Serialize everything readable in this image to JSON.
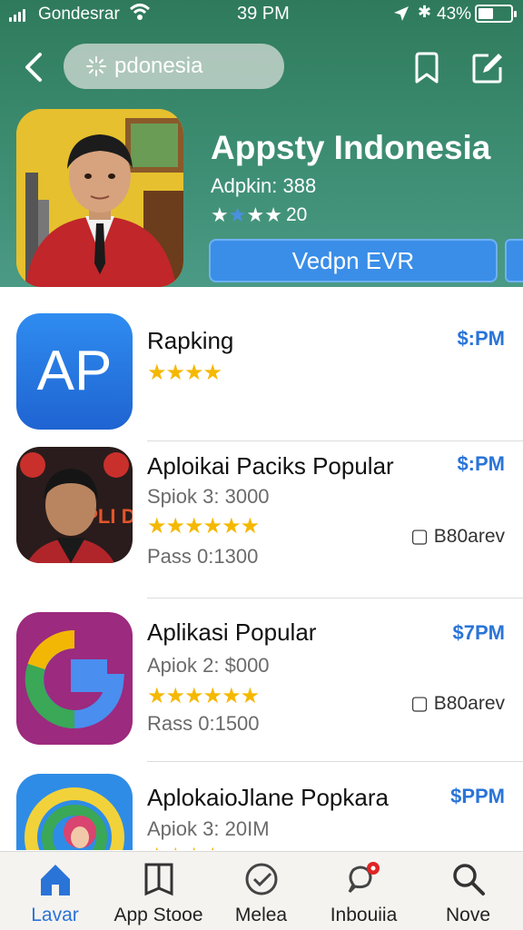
{
  "status_bar": {
    "carrier": "Gondesrar",
    "time": "39 PM",
    "battery": "43%"
  },
  "search": {
    "placeholder": "pdonesia",
    "value": "pdonesia"
  },
  "hero": {
    "title": "Appsty Indonesia",
    "subtitle": "Adpkin: 388",
    "rating_count": "20",
    "button_label": "Vedpn EVR"
  },
  "apps": [
    {
      "icon_text": "AP",
      "title": "Rapking",
      "subtitle": "",
      "stars": "★★★★",
      "rating_text": "",
      "price": "$:PM",
      "badge": ""
    },
    {
      "icon_text": "APLI DO",
      "title": "Aploikai Paciks Popular",
      "subtitle": "Spiok 3: 3000",
      "stars": "★★★★★★",
      "rating_text": "Pass 0:1300",
      "price": "$:PM",
      "badge": "B80arev"
    },
    {
      "icon_text": "G",
      "title": "Aplikasi Popular",
      "subtitle": "Apiok 2: $000",
      "stars": "★★★★★★",
      "rating_text": "Rass 0:1500",
      "price": "$7PM",
      "badge": "B80arev"
    },
    {
      "icon_text": "",
      "title": "AplokaioJlane Popkara",
      "subtitle": "Apiok 3: 20IM",
      "stars": "★★★★",
      "rating_text": "",
      "price": "$PPM",
      "badge": ""
    }
  ],
  "tabs": [
    {
      "label": "Lavar",
      "icon": "home-icon",
      "active": true
    },
    {
      "label": "App Stooe",
      "icon": "book-icon",
      "active": false
    },
    {
      "label": "Melea",
      "icon": "check-circle-icon",
      "active": false
    },
    {
      "label": "Inbouiia",
      "icon": "chat-bell-icon",
      "active": false
    },
    {
      "label": "Nove",
      "icon": "search-icon",
      "active": false
    }
  ],
  "colors": {
    "header_green": "#3a8a6e",
    "accent_blue": "#2a74d8",
    "star_gold": "#f5b800"
  }
}
